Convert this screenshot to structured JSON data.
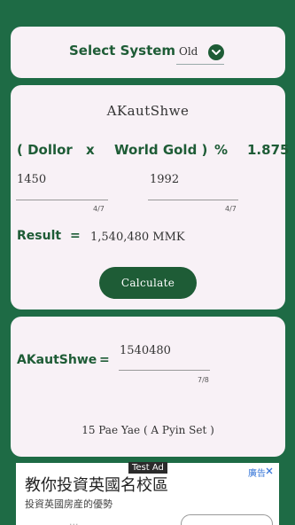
{
  "select_system": {
    "label": "Select System",
    "value": "Old"
  },
  "calculator": {
    "title": "AKautShwe",
    "formula": {
      "open_paren_dollar": "( Dollor",
      "multiply": "x",
      "world_gold_close": "World Gold )",
      "percent": "%",
      "divisor": "1.875"
    },
    "dollar_input": {
      "value": "1450",
      "fraction": "4/7"
    },
    "gold_input": {
      "value": "1992",
      "fraction": "4/7"
    },
    "result": {
      "label": "Result",
      "equals": "=",
      "value": "1,540,480 MMK"
    },
    "calculate_label": "Calculate"
  },
  "akautshwe": {
    "label": "AKautShwe",
    "equals": "=",
    "value": "1540480",
    "fraction": "7/8",
    "pyin_set": "15 Pae Yae ( A Pyin Set )"
  },
  "ad": {
    "tag": "Test Ad",
    "headline": "教你投資英國名校區",
    "subline": "投資英國房産的優勢",
    "chip": "廣告",
    "faint_text": "..."
  },
  "colors": {
    "background": "#1e6b45",
    "card": "#f8f1f6",
    "accent": "#1e5c36",
    "ad_chip": "#3a78d8"
  }
}
